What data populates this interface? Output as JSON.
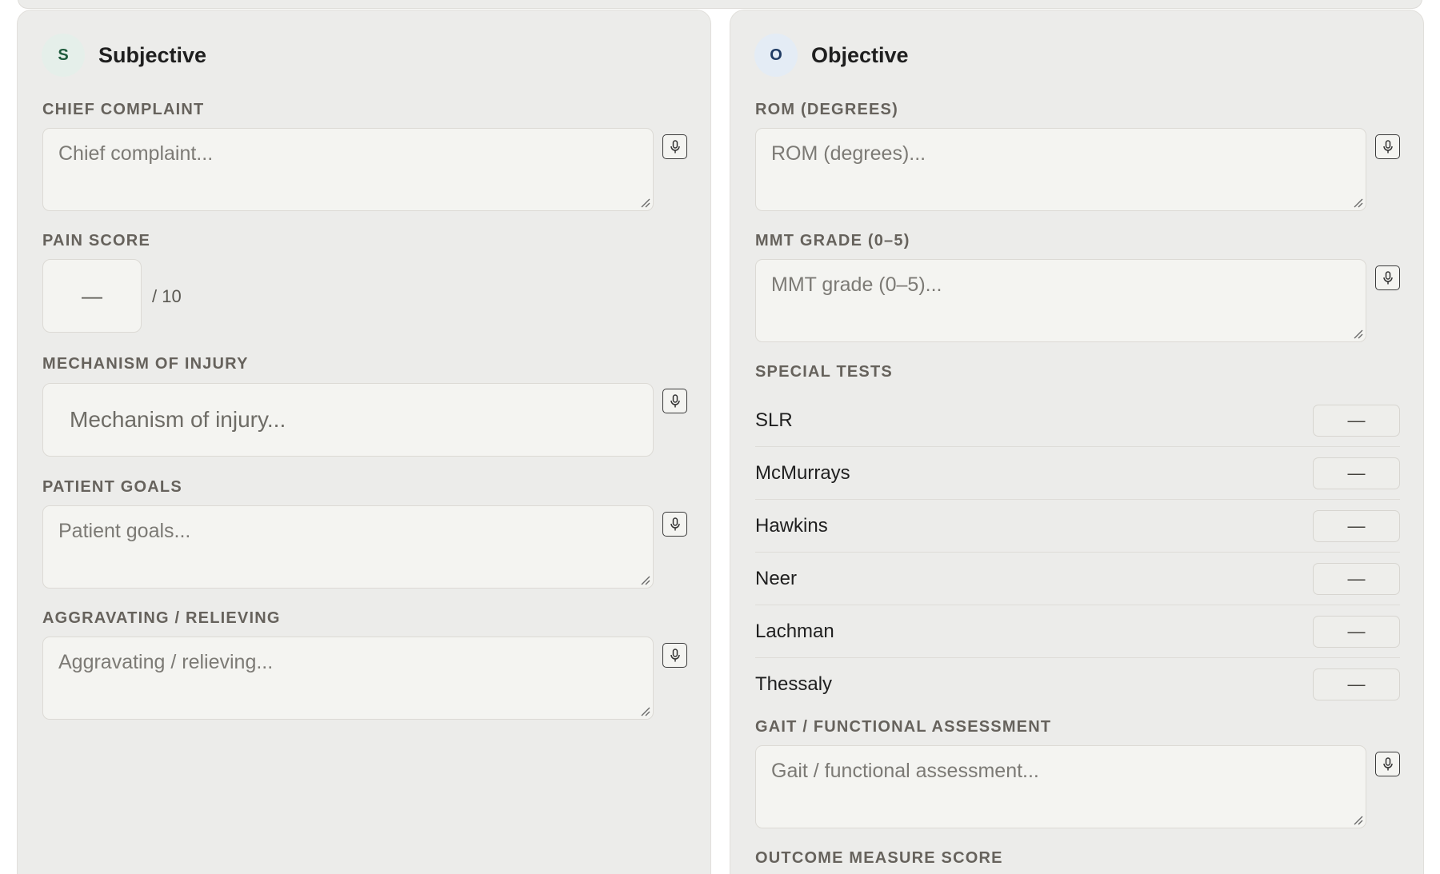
{
  "subjective": {
    "badge": "S",
    "title": "Subjective",
    "chief_complaint": {
      "label": "CHIEF COMPLAINT",
      "placeholder": "Chief complaint..."
    },
    "pain_score": {
      "label": "PAIN SCORE",
      "value": "—",
      "suffix": "/ 10"
    },
    "mechanism": {
      "label": "MECHANISM OF INJURY",
      "placeholder": "Mechanism of injury..."
    },
    "patient_goals": {
      "label": "PATIENT GOALS",
      "placeholder": "Patient goals..."
    },
    "aggravating": {
      "label": "AGGRAVATING / RELIEVING",
      "placeholder": "Aggravating / relieving..."
    }
  },
  "objective": {
    "badge": "O",
    "title": "Objective",
    "rom": {
      "label": "ROM (DEGREES)",
      "placeholder": "ROM (degrees)..."
    },
    "mmt": {
      "label": "MMT GRADE (0–5)",
      "placeholder": "MMT grade (0–5)..."
    },
    "special_tests": {
      "label": "SPECIAL TESTS",
      "items": [
        {
          "name": "SLR",
          "value": "—"
        },
        {
          "name": "McMurrays",
          "value": "—"
        },
        {
          "name": "Hawkins",
          "value": "—"
        },
        {
          "name": "Neer",
          "value": "—"
        },
        {
          "name": "Lachman",
          "value": "—"
        },
        {
          "name": "Thessaly",
          "value": "—"
        }
      ]
    },
    "gait": {
      "label": "GAIT / FUNCTIONAL ASSESSMENT",
      "placeholder": "Gait / functional assessment..."
    },
    "outcome": {
      "label": "OUTCOME MEASURE SCORE"
    }
  },
  "icons": {
    "mic": "microphone-icon",
    "resize": "resize-grip-icon"
  }
}
